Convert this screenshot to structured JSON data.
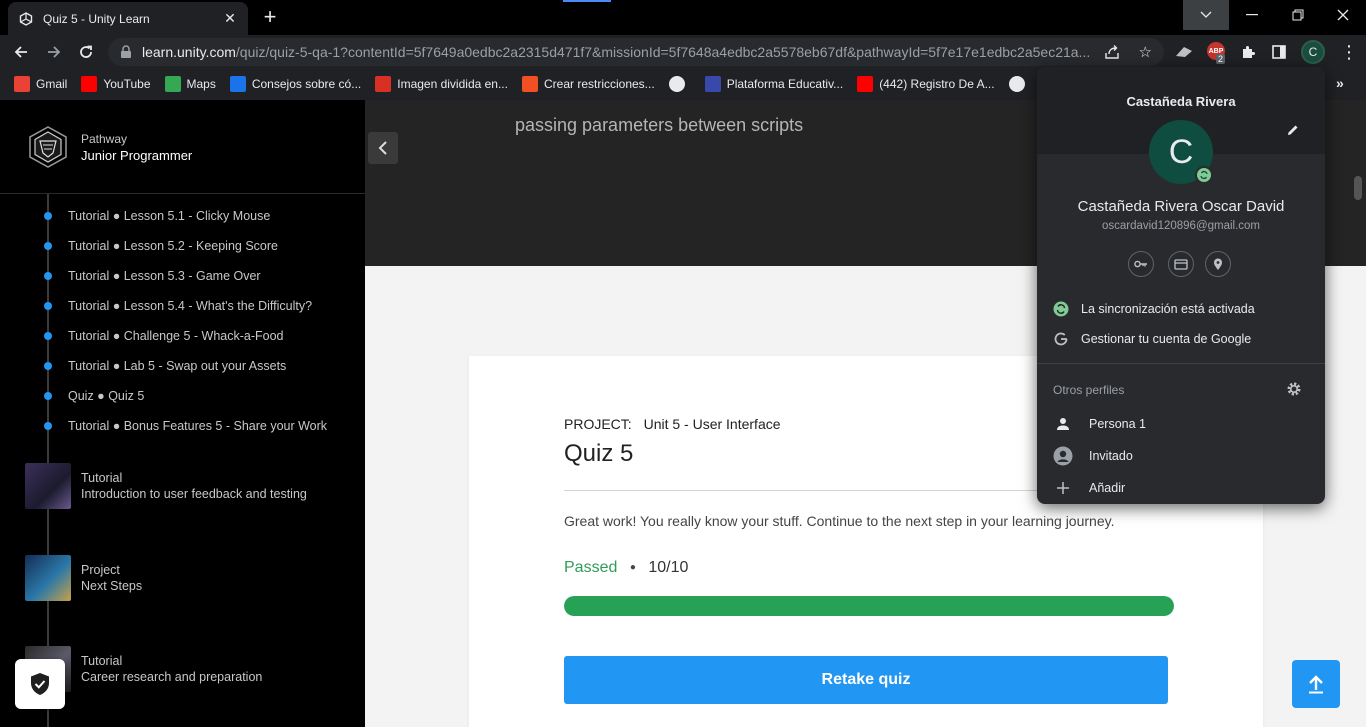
{
  "browser": {
    "tab_title": "Quiz 5 - Unity Learn",
    "url_host": "learn.unity.com",
    "url_path": "/quiz/quiz-5-qa-1?contentId=5f7649a0edbc2a2315d471f7&missionId=5f7648a4edbc2a5578eb67df&pathwayId=5f7e17e1edbc2a5ec21a...",
    "adblock_count": "2",
    "adblock_label": "ABP",
    "profile_initial": "C"
  },
  "bookmarks": [
    {
      "label": "Gmail",
      "icon": "gmail-icon",
      "color": "#ea4335"
    },
    {
      "label": "YouTube",
      "icon": "youtube-icon",
      "color": "#ff0000"
    },
    {
      "label": "Maps",
      "icon": "maps-icon",
      "color": "#34a853"
    },
    {
      "label": "Consejos sobre có...",
      "icon": "consejos-icon",
      "color": "#1a73e8"
    },
    {
      "label": "Imagen dividida en...",
      "icon": "imagen-icon",
      "color": "#d93025"
    },
    {
      "label": "Crear restricciones...",
      "icon": "microsoft-icon",
      "color": "#f25022"
    },
    {
      "label": "",
      "icon": "globe-icon",
      "color": "#5f6368"
    },
    {
      "label": "Plataforma Educativ...",
      "icon": "plataforma-icon",
      "color": "#3949ab"
    },
    {
      "label": "(442) Registro De A...",
      "icon": "youtube-icon",
      "color": "#ff0000"
    },
    {
      "label": "",
      "icon": "circle-icon",
      "color": "#5f6368"
    }
  ],
  "sidebar": {
    "kicker": "Pathway",
    "pathway_name": "Junior Programmer",
    "lessons": [
      "Tutorial ● Lesson 5.1 - Clicky Mouse",
      "Tutorial ● Lesson 5.2 - Keeping Score",
      "Tutorial ● Lesson 5.3 - Game Over",
      "Tutorial ● Lesson 5.4 - What's the Difficulty?",
      "Tutorial ● Challenge 5 - Whack-a-Food",
      "Tutorial ● Lab 5 - Swap out your Assets",
      "Quiz ● Quiz 5",
      "Tutorial ● Bonus Features 5 - Share your Work"
    ],
    "modules": [
      {
        "kind": "Tutorial",
        "title": "Introduction to user feedback and testing"
      },
      {
        "kind": "Project",
        "title": "Next Steps"
      },
      {
        "kind": "Tutorial",
        "title": "Career research and preparation"
      }
    ]
  },
  "hero": {
    "subtitle": "passing parameters between scripts"
  },
  "quiz": {
    "project_label": "PROJECT:",
    "project_name": "Unit 5 - User Interface",
    "title": "Quiz 5",
    "message": "Great work! You really know your stuff. Continue to the next step in your learning journey.",
    "status": "Passed",
    "separator": "●",
    "score": "10/10",
    "progress": 1.0,
    "retake_label": "Retake quiz"
  },
  "profile_menu": {
    "header_name": "Castañeda Rivera",
    "avatar_initial": "C",
    "full_name": "Castañeda Rivera Oscar David",
    "email": "oscardavid120896@gmail.com",
    "sync_label": "La sincronización está activada",
    "manage_label": "Gestionar tu cuenta de Google",
    "others_label": "Otros perfiles",
    "profiles": [
      "Persona 1",
      "Invitado",
      "Añadir"
    ]
  },
  "colors": {
    "accent": "#2196f3",
    "passed": "#2e9d58",
    "progress_fill": "#27a155"
  }
}
